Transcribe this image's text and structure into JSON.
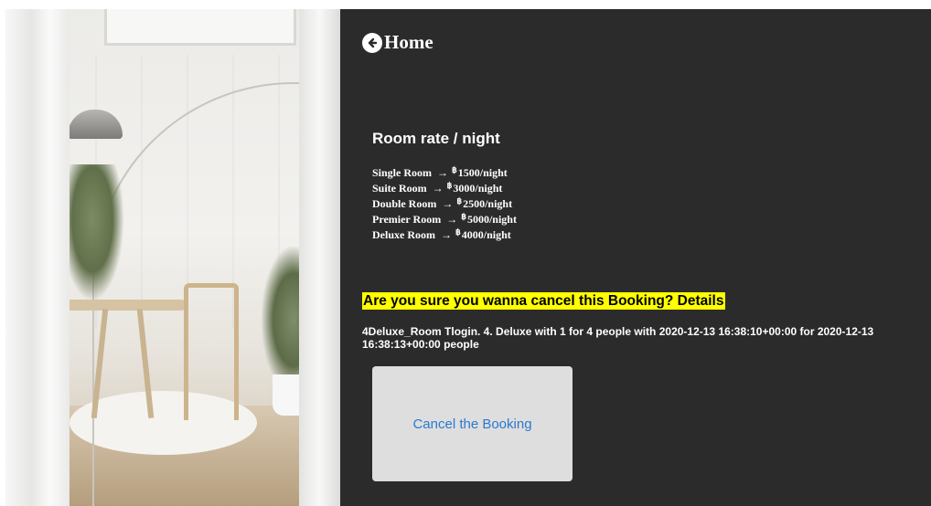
{
  "hero_image": {
    "alt": "Bright room with arc floor lamp, round wooden table, chair, plants and white curtains",
    "scene_icons": [
      "arc-lamp-icon",
      "plant-icon",
      "table-icon",
      "chair-icon"
    ]
  },
  "nav": {
    "home_label": "Home",
    "home_icon": "arrow-left-circle-icon"
  },
  "rates": {
    "title": "Room rate / night",
    "arrow": "→",
    "currency_symbol": "฿",
    "items": [
      {
        "room": "Single Room",
        "price": "1500/night"
      },
      {
        "room": "Suite Room",
        "price": "3000/night"
      },
      {
        "room": "Double Room",
        "price": "2500/night"
      },
      {
        "room": "Premier Room",
        "price": "5000/night"
      },
      {
        "room": "Deluxe Room",
        "price": "4000/night"
      }
    ]
  },
  "confirm": {
    "question": "Are you sure you wanna cancel this Booking? Details",
    "details": "4Deluxe_Room Tlogin. 4. Deluxe with 1 for 4 people with 2020-12-13 16:38:10+00:00 for 2020-12-13 16:38:13+00:00 people",
    "cancel_button": "Cancel the Booking"
  },
  "colors": {
    "panel_bg": "#2b2b2b",
    "highlight": "#ffff00",
    "button_bg": "#dedede",
    "button_text": "#2b79d0"
  }
}
